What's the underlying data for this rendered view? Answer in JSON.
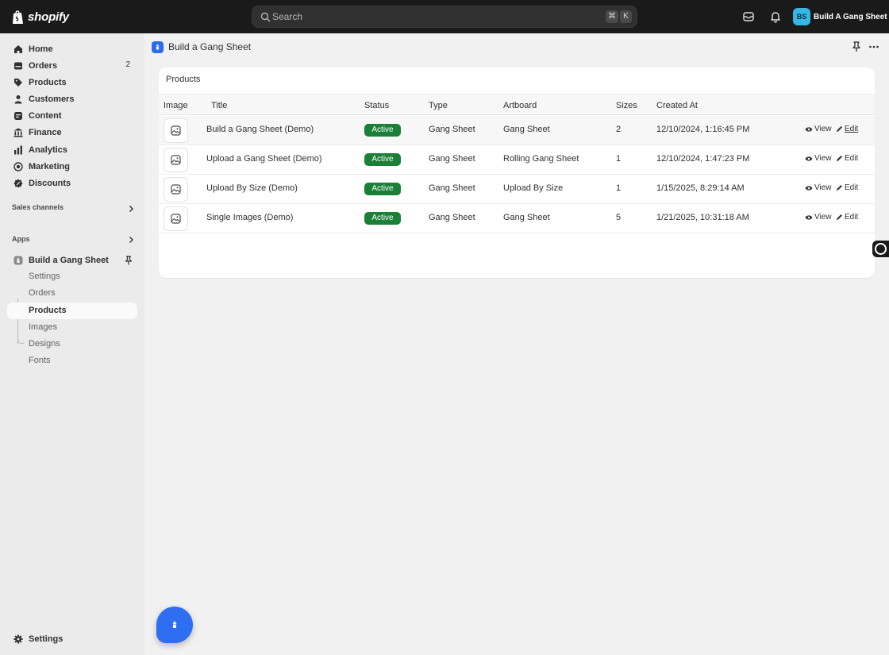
{
  "topbar": {
    "logo_text": "shopify",
    "search_placeholder": "Search",
    "shortcut_key1": "⌘",
    "shortcut_key2": "K",
    "avatar_initials": "BS",
    "store_name": "Build A Gang Sheet"
  },
  "sidebar": {
    "nav": [
      {
        "label": "Home",
        "icon": "home-icon"
      },
      {
        "label": "Orders",
        "icon": "orders-icon",
        "badge": "2"
      },
      {
        "label": "Products",
        "icon": "tag-icon"
      },
      {
        "label": "Customers",
        "icon": "person-icon"
      },
      {
        "label": "Content",
        "icon": "content-icon"
      },
      {
        "label": "Finance",
        "icon": "bank-icon"
      },
      {
        "label": "Analytics",
        "icon": "bar-chart-icon"
      },
      {
        "label": "Marketing",
        "icon": "target-icon"
      },
      {
        "label": "Discounts",
        "icon": "discount-icon"
      }
    ],
    "sales_channels": "Sales channels",
    "apps": "Apps",
    "app_name": "Build a Gang Sheet",
    "app_sub": [
      "Settings",
      "Orders",
      "Products",
      "Images",
      "Designs",
      "Fonts"
    ],
    "active_sub": "Products",
    "settings": "Settings"
  },
  "main": {
    "app_title": "Build a Gang Sheet",
    "card_title": "Products",
    "columns": [
      "Image",
      "Title",
      "Status",
      "Type",
      "Artboard",
      "Sizes",
      "Created At"
    ],
    "view_label": "View",
    "edit_label": "Edit",
    "rows": [
      {
        "title": "Build a Gang Sheet (Demo)",
        "status": "Active",
        "type": "Gang Sheet",
        "artboard": "Gang Sheet",
        "sizes": "2",
        "created": "12/10/2024, 1:16:45 PM"
      },
      {
        "title": "Upload a Gang Sheet (Demo)",
        "status": "Active",
        "type": "Gang Sheet",
        "artboard": "Rolling Gang Sheet",
        "sizes": "1",
        "created": "12/10/2024, 1:47:23 PM"
      },
      {
        "title": "Upload By Size (Demo)",
        "status": "Active",
        "type": "Gang Sheet",
        "artboard": "Upload By Size",
        "sizes": "1",
        "created": "1/15/2025, 8:29:14 AM"
      },
      {
        "title": "Single Images (Demo)",
        "status": "Active",
        "type": "Gang Sheet",
        "artboard": "Gang Sheet",
        "sizes": "5",
        "created": "1/21/2025, 10:31:18 AM"
      }
    ]
  },
  "colors": {
    "topbar": "#1a1a1a",
    "active_badge": "#1a7f37",
    "app_accent": "#2d6ff0",
    "avatar": "#36b8e6"
  }
}
